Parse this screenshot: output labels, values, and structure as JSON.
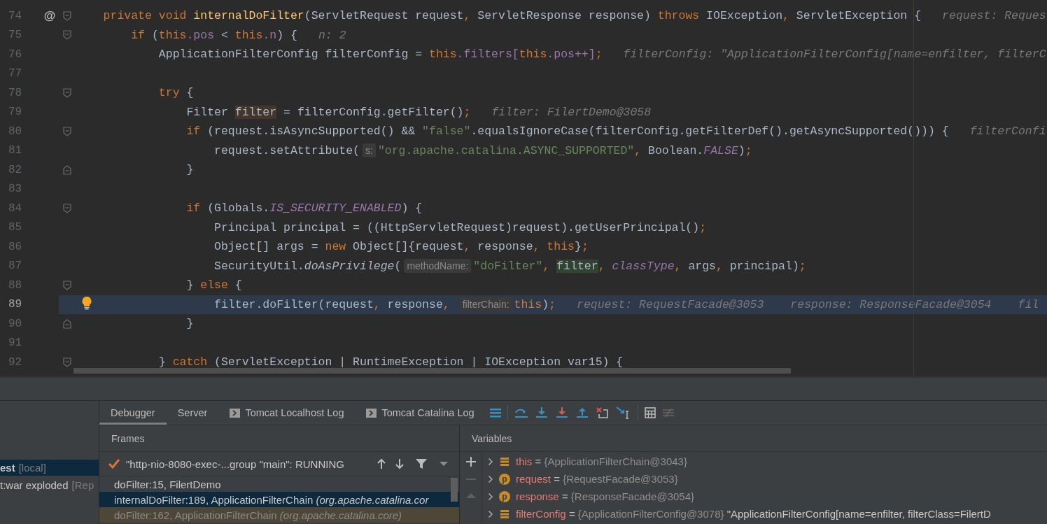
{
  "editor": {
    "lines": [
      {
        "number": "74",
        "current": false,
        "fold": {
          "kind": "start"
        },
        "gutter_mark": {
          "kind": "annotation",
          "text": "@"
        },
        "parts": [
          {
            "kind": "code",
            "tokens": [
              {
                "kind": "kw",
                "text": "    private void "
              },
              {
                "kind": "fn",
                "text": "internalDoFilter"
              },
              {
                "kind": "plain",
                "text": "(ServletRequest request"
              },
              {
                "kind": "kw",
                "text": ", "
              },
              {
                "kind": "plain",
                "text": "ServletResponse response) "
              },
              {
                "kind": "kw",
                "text": "throws "
              },
              {
                "kind": "plain",
                "text": "IOException"
              },
              {
                "kind": "kw",
                "text": ", "
              },
              {
                "kind": "plain",
                "text": "ServletException {"
              }
            ]
          }
        ],
        "values": [
          "request: Reques"
        ]
      },
      {
        "number": "75",
        "current": false,
        "fold": {
          "kind": "start"
        },
        "parts": [
          {
            "kind": "code",
            "tokens": [
              {
                "kind": "kw",
                "text": "        if "
              },
              {
                "kind": "plain",
                "text": "("
              },
              {
                "kind": "kw",
                "text": "this"
              },
              {
                "kind": "field",
                "text": ".pos"
              },
              {
                "kind": "plain",
                "text": " < "
              },
              {
                "kind": "kw",
                "text": "this"
              },
              {
                "kind": "field",
                "text": ".n"
              },
              {
                "kind": "plain",
                "text": ") {"
              }
            ]
          }
        ],
        "values": [
          "n: 2"
        ]
      },
      {
        "number": "76",
        "current": false,
        "parts": [
          {
            "kind": "code",
            "tokens": [
              {
                "kind": "plain",
                "text": "            ApplicationFilterConfig filterConfig = "
              },
              {
                "kind": "kw",
                "text": "this"
              },
              {
                "kind": "field",
                "text": ".filters["
              },
              {
                "kind": "kw",
                "text": "this"
              },
              {
                "kind": "field",
                "text": ".pos++]"
              },
              {
                "kind": "kw",
                "text": ";"
              }
            ]
          }
        ],
        "values": [
          "filterConfig: \"ApplicationFilterConfig[name=enfilter, filterC"
        ]
      },
      {
        "number": "77",
        "current": false
      },
      {
        "number": "78",
        "current": false,
        "fold": {
          "kind": "start"
        },
        "parts": [
          {
            "kind": "code",
            "tokens": [
              {
                "kind": "kw",
                "text": "            try "
              },
              {
                "kind": "plain",
                "text": "{"
              }
            ]
          }
        ]
      },
      {
        "number": "79",
        "current": false,
        "parts": [
          {
            "kind": "code",
            "tokens": [
              {
                "kind": "plain",
                "text": "                Filter "
              },
              {
                "kind": "write",
                "text": "filter"
              },
              {
                "kind": "plain",
                "text": " = filterConfig.getFilter()"
              },
              {
                "kind": "kw",
                "text": ";"
              }
            ]
          }
        ],
        "values": [
          "filter: FilertDemo@3058"
        ]
      },
      {
        "number": "80",
        "current": false,
        "fold": {
          "kind": "start"
        },
        "parts": [
          {
            "kind": "code",
            "tokens": [
              {
                "kind": "kw",
                "text": "                if "
              },
              {
                "kind": "plain",
                "text": "(request.isAsyncSupported() && "
              },
              {
                "kind": "str",
                "text": "\"false\""
              },
              {
                "kind": "plain",
                "text": ".equalsIgnoreCase(filterConfig.getFilterDef().getAsyncSupported())) {"
              }
            ]
          }
        ],
        "values": [
          "filterConfi"
        ]
      },
      {
        "number": "81",
        "current": false,
        "parts": [
          {
            "kind": "code",
            "tokens": [
              {
                "kind": "plain",
                "text": "                    request.setAttribute("
              }
            ]
          },
          {
            "kind": "inlay",
            "text": "s:"
          },
          {
            "kind": "code",
            "tokens": [
              {
                "kind": "str",
                "text": "\"org.apache.catalina.ASYNC_SUPPORTED\""
              },
              {
                "kind": "kw",
                "text": ", "
              },
              {
                "kind": "plain",
                "text": "Boolean."
              },
              {
                "kind": "static",
                "text": "FALSE"
              },
              {
                "kind": "plain",
                "text": ")"
              },
              {
                "kind": "kw",
                "text": ";"
              }
            ]
          }
        ]
      },
      {
        "number": "82",
        "current": false,
        "fold": {
          "kind": "end"
        },
        "parts": [
          {
            "kind": "code",
            "tokens": [
              {
                "kind": "plain",
                "text": "                }"
              }
            ]
          }
        ]
      },
      {
        "number": "83",
        "current": false
      },
      {
        "number": "84",
        "current": false,
        "fold": {
          "kind": "start"
        },
        "parts": [
          {
            "kind": "code",
            "tokens": [
              {
                "kind": "kw",
                "text": "                if "
              },
              {
                "kind": "plain",
                "text": "(Globals."
              },
              {
                "kind": "static",
                "text": "IS_SECURITY_ENABLED"
              },
              {
                "kind": "plain",
                "text": ") {"
              }
            ]
          }
        ]
      },
      {
        "number": "85",
        "current": false,
        "parts": [
          {
            "kind": "code",
            "tokens": [
              {
                "kind": "plain",
                "text": "                    Principal principal = ((HttpServletRequest)request).getUserPrincipal()"
              },
              {
                "kind": "kw",
                "text": ";"
              }
            ]
          }
        ]
      },
      {
        "number": "86",
        "current": false,
        "parts": [
          {
            "kind": "code",
            "tokens": [
              {
                "kind": "plain",
                "text": "                    Object[] args = "
              },
              {
                "kind": "kw",
                "text": "new "
              },
              {
                "kind": "plain",
                "text": "Object[]{request"
              },
              {
                "kind": "kw",
                "text": ", "
              },
              {
                "kind": "plain",
                "text": "response"
              },
              {
                "kind": "kw",
                "text": ", this"
              },
              {
                "kind": "plain",
                "text": "}"
              },
              {
                "kind": "kw",
                "text": ";"
              }
            ]
          }
        ]
      },
      {
        "number": "87",
        "current": false,
        "parts": [
          {
            "kind": "code",
            "tokens": [
              {
                "kind": "plain",
                "text": "                    SecurityUtil."
              },
              {
                "kind": "italic",
                "text": "doAsPrivilege"
              },
              {
                "kind": "plain",
                "text": "("
              }
            ]
          },
          {
            "kind": "inlay",
            "text": "methodName:"
          },
          {
            "kind": "code",
            "tokens": [
              {
                "kind": "str",
                "text": "\"doFilter\""
              },
              {
                "kind": "kw",
                "text": ", "
              },
              {
                "kind": "read",
                "text": "filter"
              },
              {
                "kind": "kw",
                "text": ", "
              },
              {
                "kind": "static",
                "text": "classType"
              },
              {
                "kind": "kw",
                "text": ", "
              },
              {
                "kind": "plain",
                "text": "args"
              },
              {
                "kind": "kw",
                "text": ", "
              },
              {
                "kind": "plain",
                "text": "principal)"
              },
              {
                "kind": "kw",
                "text": ";"
              }
            ]
          }
        ]
      },
      {
        "number": "88",
        "current": false,
        "fold": {
          "kind": "start"
        },
        "parts": [
          {
            "kind": "code",
            "tokens": [
              {
                "kind": "plain",
                "text": "                } "
              },
              {
                "kind": "kw",
                "text": "else "
              },
              {
                "kind": "plain",
                "text": "{"
              }
            ]
          }
        ]
      },
      {
        "number": "89",
        "current": true,
        "gutter_mark": {
          "kind": "bulb"
        },
        "parts": [
          {
            "kind": "code",
            "tokens": [
              {
                "kind": "plain",
                "text": "                    filter.doFilter(request"
              },
              {
                "kind": "kw",
                "text": ", "
              },
              {
                "kind": "plain",
                "text": "response"
              },
              {
                "kind": "kw",
                "text": ", "
              }
            ]
          },
          {
            "kind": "inlay",
            "text": "filterChain:"
          },
          {
            "kind": "code",
            "tokens": [
              {
                "kind": "kw",
                "text": "this"
              },
              {
                "kind": "plain",
                "text": ")"
              },
              {
                "kind": "kw",
                "text": ";"
              }
            ]
          }
        ],
        "values": [
          "request: RequestFacade@3053",
          "response: ResponseFacade@3054",
          "fil"
        ]
      },
      {
        "number": "90",
        "current": false,
        "fold": {
          "kind": "end"
        },
        "parts": [
          {
            "kind": "code",
            "tokens": [
              {
                "kind": "plain",
                "text": "                }"
              }
            ]
          }
        ]
      },
      {
        "number": "91",
        "current": false
      },
      {
        "number": "92",
        "current": false,
        "fold": {
          "kind": "start"
        },
        "parts": [
          {
            "kind": "code",
            "tokens": [
              {
                "kind": "plain",
                "text": "            } "
              },
              {
                "kind": "kw",
                "text": "catch "
              },
              {
                "kind": "plain",
                "text": "(ServletException | RuntimeException | IOException var15) {"
              }
            ]
          }
        ]
      }
    ]
  },
  "services": {
    "items": [
      {
        "name": "est",
        "tag": "[local]",
        "selected": true
      },
      {
        "name": "t:war exploded",
        "tag": "[Rep",
        "selected": false
      }
    ]
  },
  "debug_tabs": [
    {
      "label": "Debugger",
      "selected": true,
      "kind": "plain"
    },
    {
      "label": "Server",
      "selected": false,
      "kind": "plain"
    },
    {
      "label": "Tomcat Localhost Log",
      "selected": false,
      "kind": "console"
    },
    {
      "label": "Tomcat Catalina Log",
      "selected": false,
      "kind": "console"
    }
  ],
  "frames": {
    "title": "Frames",
    "thread": "\"http-nio-8080-exec-...group \"main\": RUNNING",
    "items": [
      {
        "text": "doFilter:15, FilertDemo",
        "selected": false,
        "kind": "project"
      },
      {
        "text": "internalDoFilter:189, ApplicationFilterChain",
        "detail": "(org.apache.catalina.cor",
        "selected": true,
        "kind": "project"
      },
      {
        "text": "doFilter:162, ApplicationFilterChain",
        "detail": "(org.apache.catalina.core)",
        "selected": false,
        "kind": "library"
      }
    ]
  },
  "variables": {
    "title": "Variables",
    "items": [
      {
        "kind": "field",
        "name": "this",
        "operator": "=",
        "value": "{ApplicationFilterChain@3043}"
      },
      {
        "kind": "param",
        "badge": "p",
        "name": "request",
        "operator": "=",
        "value": "{RequestFacade@3053}"
      },
      {
        "kind": "param",
        "badge": "p",
        "name": "response",
        "operator": "=",
        "value": "{ResponseFacade@3054}"
      },
      {
        "kind": "field",
        "name": "filterConfig",
        "operator": "=",
        "value": "{ApplicationFilterConfig@3078}",
        "extra": "\"ApplicationFilterConfig[name=enfilter, filterClass=FilertD"
      }
    ]
  }
}
